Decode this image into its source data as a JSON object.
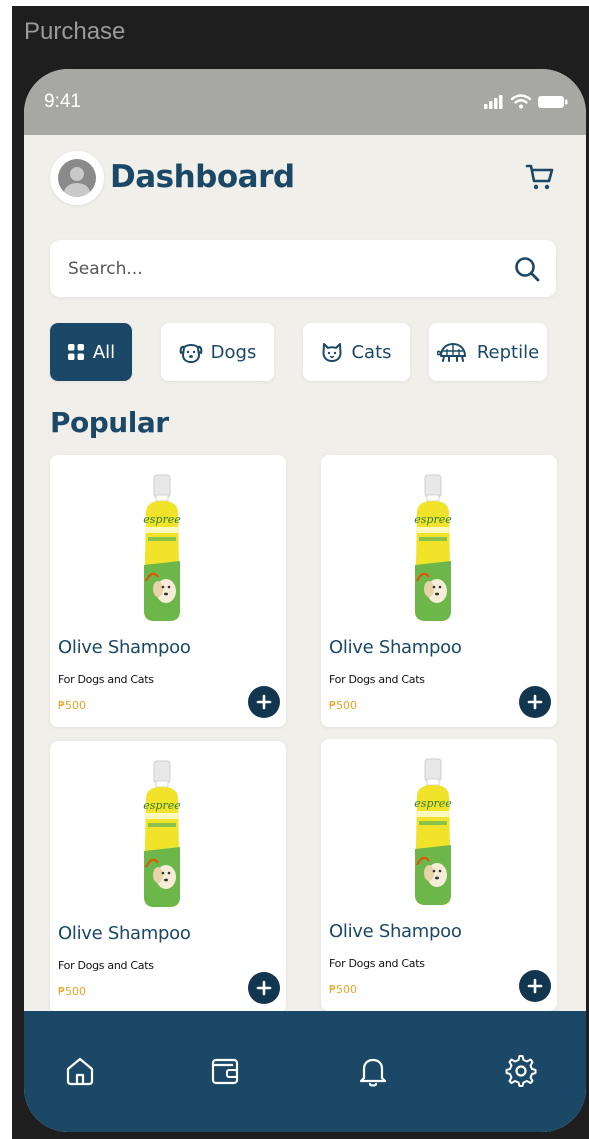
{
  "frame": {
    "label": "Purchase"
  },
  "status_bar": {
    "time": "9:41",
    "icons": [
      "signal-icon",
      "wifi-icon",
      "battery-icon"
    ]
  },
  "header": {
    "title": "Dashboard",
    "avatar_icon": "avatar-icon",
    "cart_icon": "cart-icon"
  },
  "search": {
    "placeholder": "Search...",
    "value": "",
    "icon": "search-icon"
  },
  "categories": [
    {
      "label": "All",
      "icon": "grid-icon",
      "active": true
    },
    {
      "label": "Dogs",
      "icon": "dog-icon",
      "active": false
    },
    {
      "label": "Cats",
      "icon": "cat-icon",
      "active": false
    },
    {
      "label": "Reptile",
      "icon": "turtle-icon",
      "active": false
    }
  ],
  "popular": {
    "title": "Popular",
    "products": [
      {
        "name": "Olive Shampoo",
        "desc": "For Dogs and Cats",
        "price": "₱500"
      },
      {
        "name": "Olive Shampoo",
        "desc": "For Dogs and Cats",
        "price": "₱500"
      },
      {
        "name": "Olive Shampoo",
        "desc": "For Dogs and Cats",
        "price": "₱500"
      },
      {
        "name": "Olive Shampoo",
        "desc": "For Dogs and Cats",
        "price": "₱500"
      }
    ]
  },
  "bottom_nav": [
    "home-icon",
    "wallet-icon",
    "bell-icon",
    "settings-icon"
  ],
  "colors": {
    "primary": "#1b4866",
    "background": "#f1efea",
    "price": "#e2a62a",
    "status_bar": "#a7a7a3"
  }
}
